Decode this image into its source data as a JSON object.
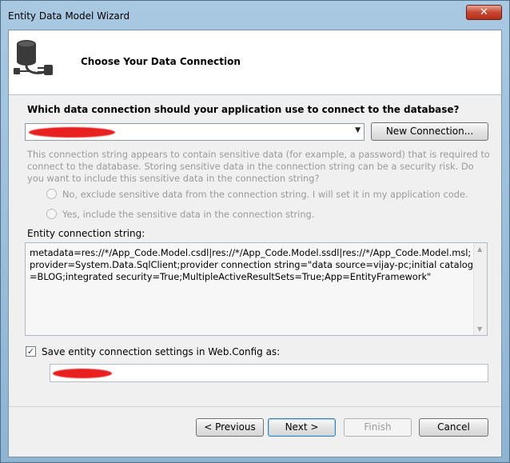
{
  "window": {
    "title": "Entity Data Model Wizard",
    "close_glyph": "✕"
  },
  "header": {
    "title": "Choose Your Data Connection",
    "icon": "database-plug-icon"
  },
  "connection": {
    "question": "Which data connection should your application use to connect to the database?",
    "selected_value": "",
    "new_connection_label": "New Connection..."
  },
  "sensitive": {
    "warning": "This connection string appears to contain sensitive data (for example, a password) that is required to connect to the database. Storing sensitive data in the connection string can be a security risk. Do you want to include this sensitive data in the connection string?",
    "option_exclude": "No, exclude sensitive data from the connection string. I will set it in my application code.",
    "option_include": "Yes, include the sensitive data in the connection string."
  },
  "entity_connection": {
    "label": "Entity connection string:",
    "value": "metadata=res://*/App_Code.Model.csdl|res://*/App_Code.Model.ssdl|res://*/App_Code.Model.msl;provider=System.Data.SqlClient;provider connection string=\"data source=vijay-pc;initial catalog=BLOG;integrated security=True;MultipleActiveResultSets=True;App=EntityFramework\""
  },
  "save_settings": {
    "checked": true,
    "check_glyph": "✓",
    "label": "Save entity connection settings in Web.Config as:",
    "value": ""
  },
  "buttons": {
    "previous": "< Previous",
    "next": "Next >",
    "finish": "Finish",
    "cancel": "Cancel"
  },
  "colors": {
    "redaction": "#e8201f",
    "close_button": "#c84630"
  }
}
